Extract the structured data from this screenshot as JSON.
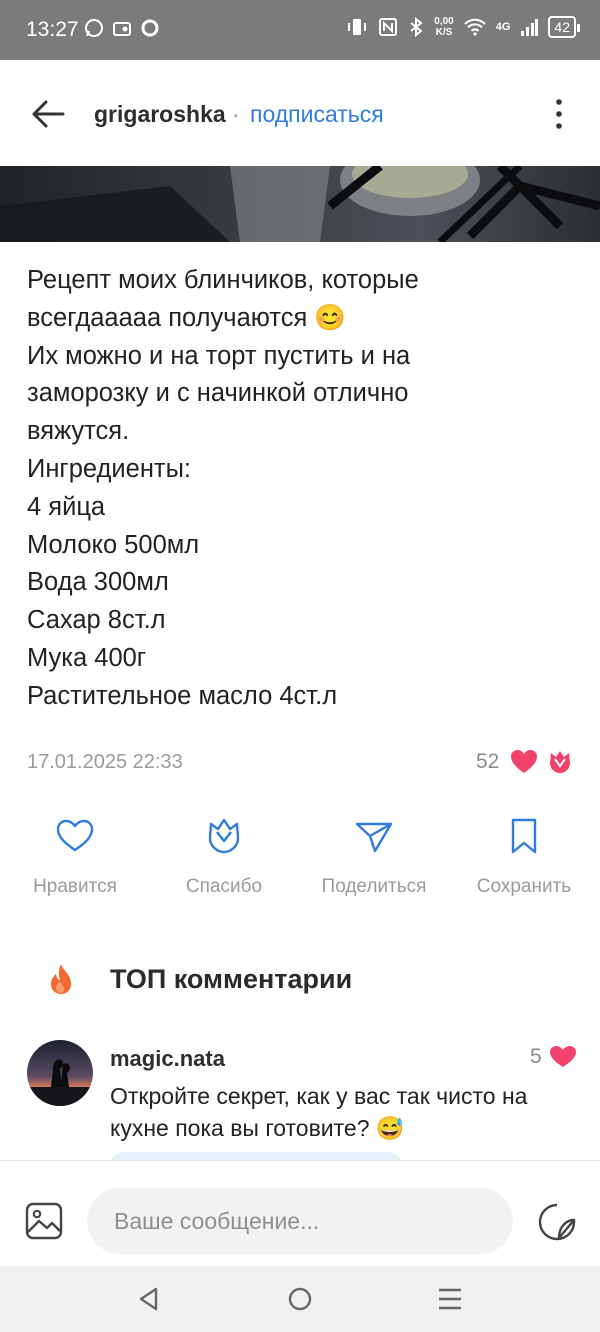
{
  "status_bar": {
    "time": "13:27",
    "net_speed_value": "0,00",
    "net_speed_unit": "K/S",
    "network": "4G",
    "battery": "42"
  },
  "header": {
    "username": "grigaroshka",
    "separator": "·",
    "subscribe_label": "подписаться"
  },
  "post": {
    "text": "Рецепт моих блинчиков, которые\nвсегдааааа получаются 😊\nИх можно и на торт пустить и на\nзаморозку и с начинкой отлично\nвяжутся.\nИнгредиенты:\n4 яйца\nМолоко 500мл\nВода 300мл\nСахар 8ст.л\nМука 400г\nРастительное масло 4ст.л",
    "date": "17.01.2025 22:33",
    "likes": "52"
  },
  "actions": [
    {
      "label": "Нравится",
      "icon": "heart-icon"
    },
    {
      "label": "Спасибо",
      "icon": "flower-icon"
    },
    {
      "label": "Поделиться",
      "icon": "share-icon"
    },
    {
      "label": "Сохранить",
      "icon": "bookmark-icon"
    }
  ],
  "top_comments": {
    "title": "ТОП комментарии",
    "items": [
      {
        "author": "magic.nata",
        "likes": "5",
        "text": "Откройте секрет, как у вас так чисто на кухне пока вы готовите? 😅"
      }
    ]
  },
  "composer": {
    "placeholder": "Ваше сообщение..."
  },
  "colors": {
    "accent": "#2f7be0",
    "heart": "#f2426b",
    "fire": "#f26a2e",
    "status_bar": "#7b7b7b"
  }
}
